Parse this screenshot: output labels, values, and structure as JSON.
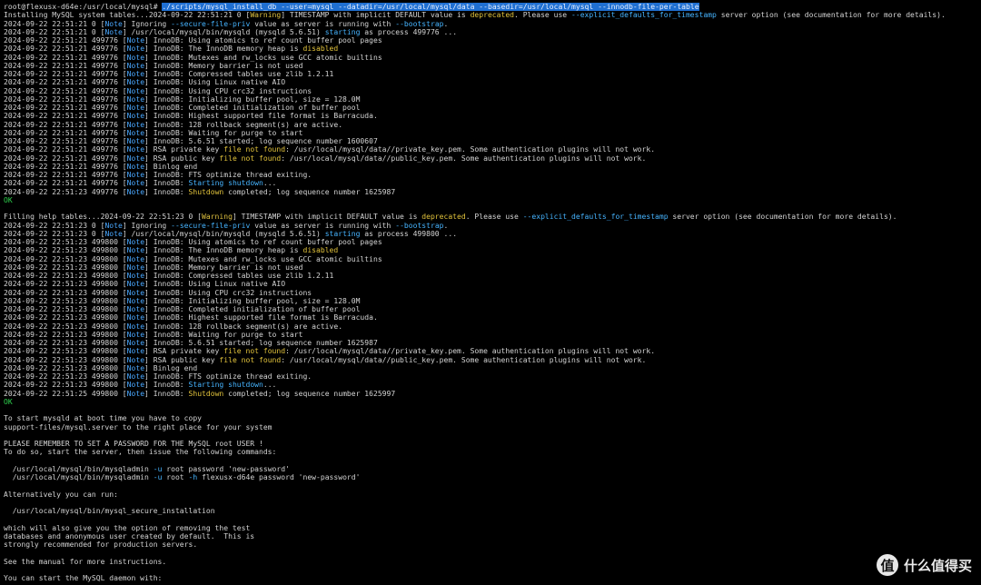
{
  "window": {
    "title": "root@flexusx-d64e: /usr/local/mysql"
  },
  "colors": {
    "background": "#000000",
    "text": "#d4d4d4",
    "note": "#4aa8ff",
    "warning": "#e0c240",
    "ok": "#2fd24e",
    "selection": "#1f6fd1"
  },
  "terminal": {
    "lines": [
      [
        [
          "root@flexusx-d64e:/usr/local/mysql# ",
          ""
        ],
        [
          "./scripts/mysql_install_db ",
          "sel"
        ],
        [
          "--user",
          "sel"
        ],
        [
          "=mysql ",
          "sel"
        ],
        [
          "--datadir",
          "sel"
        ],
        [
          "=/usr/local/mysql/data ",
          "sel"
        ],
        [
          "--basedir",
          "sel"
        ],
        [
          "=/usr/local/mysql ",
          "sel"
        ],
        [
          "--innodb-file-per-table",
          "sel"
        ]
      ],
      [
        [
          "Installing MySQL system tables...2024-09-22 22:51:21 0 [",
          ""
        ],
        [
          "Warning",
          "warn"
        ],
        [
          "] TIMESTAMP with implicit DEFAULT value is ",
          ""
        ],
        [
          "deprecated",
          "yel"
        ],
        [
          ". Please use ",
          ""
        ],
        [
          "--explicit_defaults_for_timestamp",
          "cyan"
        ],
        [
          " server option (see documentation for more details).",
          ""
        ]
      ],
      [
        [
          "2024-09-22 22:51:21 0 [",
          ""
        ],
        [
          "Note",
          "note"
        ],
        [
          "] Ignoring ",
          ""
        ],
        [
          "--secure-file-priv",
          "cyan"
        ],
        [
          " value as server is running with ",
          ""
        ],
        [
          "--bootstrap",
          "cyan"
        ],
        [
          ".",
          ""
        ]
      ],
      [
        [
          "2024-09-22 22:51:21 0 [",
          ""
        ],
        [
          "Note",
          "note"
        ],
        [
          "] /usr/local/mysql/bin/mysqld (mysqld 5.6.51) ",
          ""
        ],
        [
          "starting",
          "cyan"
        ],
        [
          " as process 499776 ...",
          ""
        ]
      ],
      [
        [
          "2024-09-22 22:51:21 499776 [",
          ""
        ],
        [
          "Note",
          "note"
        ],
        [
          "] InnoDB: Using atomics to ref count buffer pool pages",
          ""
        ]
      ],
      [
        [
          "2024-09-22 22:51:21 499776 [",
          ""
        ],
        [
          "Note",
          "note"
        ],
        [
          "] InnoDB: The InnoDB memory heap is ",
          ""
        ],
        [
          "disabled",
          "yel"
        ]
      ],
      [
        [
          "2024-09-22 22:51:21 499776 [",
          ""
        ],
        [
          "Note",
          "note"
        ],
        [
          "] InnoDB: Mutexes and rw_locks use GCC atomic builtins",
          ""
        ]
      ],
      [
        [
          "2024-09-22 22:51:21 499776 [",
          ""
        ],
        [
          "Note",
          "note"
        ],
        [
          "] InnoDB: Memory barrier is not used",
          ""
        ]
      ],
      [
        [
          "2024-09-22 22:51:21 499776 [",
          ""
        ],
        [
          "Note",
          "note"
        ],
        [
          "] InnoDB: Compressed tables use zlib 1.2.11",
          ""
        ]
      ],
      [
        [
          "2024-09-22 22:51:21 499776 [",
          ""
        ],
        [
          "Note",
          "note"
        ],
        [
          "] InnoDB: Using Linux native AIO",
          ""
        ]
      ],
      [
        [
          "2024-09-22 22:51:21 499776 [",
          ""
        ],
        [
          "Note",
          "note"
        ],
        [
          "] InnoDB: Using CPU crc32 instructions",
          ""
        ]
      ],
      [
        [
          "2024-09-22 22:51:21 499776 [",
          ""
        ],
        [
          "Note",
          "note"
        ],
        [
          "] InnoDB: Initializing buffer pool, size = 128.0M",
          ""
        ]
      ],
      [
        [
          "2024-09-22 22:51:21 499776 [",
          ""
        ],
        [
          "Note",
          "note"
        ],
        [
          "] InnoDB: Completed initialization of buffer pool",
          ""
        ]
      ],
      [
        [
          "2024-09-22 22:51:21 499776 [",
          ""
        ],
        [
          "Note",
          "note"
        ],
        [
          "] InnoDB: Highest supported file format is Barracuda.",
          ""
        ]
      ],
      [
        [
          "2024-09-22 22:51:21 499776 [",
          ""
        ],
        [
          "Note",
          "note"
        ],
        [
          "] InnoDB: 128 rollback segment(s) are active.",
          ""
        ]
      ],
      [
        [
          "2024-09-22 22:51:21 499776 [",
          ""
        ],
        [
          "Note",
          "note"
        ],
        [
          "] InnoDB: Waiting for purge to start",
          ""
        ]
      ],
      [
        [
          "2024-09-22 22:51:21 499776 [",
          ""
        ],
        [
          "Note",
          "note"
        ],
        [
          "] InnoDB: 5.6.51 started; log sequence number 1600607",
          ""
        ]
      ],
      [
        [
          "2024-09-22 22:51:21 499776 [",
          ""
        ],
        [
          "Note",
          "note"
        ],
        [
          "] RSA private key ",
          ""
        ],
        [
          "file not found",
          "yel"
        ],
        [
          ": /usr/local/mysql/data//private_key.pem. Some authentication plugins will not work.",
          ""
        ]
      ],
      [
        [
          "2024-09-22 22:51:21 499776 [",
          ""
        ],
        [
          "Note",
          "note"
        ],
        [
          "] RSA public key ",
          ""
        ],
        [
          "file not found",
          "yel"
        ],
        [
          ": /usr/local/mysql/data//public_key.pem. Some authentication plugins will not work.",
          ""
        ]
      ],
      [
        [
          "2024-09-22 22:51:21 499776 [",
          ""
        ],
        [
          "Note",
          "note"
        ],
        [
          "] Binlog end",
          ""
        ]
      ],
      [
        [
          "2024-09-22 22:51:21 499776 [",
          ""
        ],
        [
          "Note",
          "note"
        ],
        [
          "] InnoDB: FTS optimize thread exiting.",
          ""
        ]
      ],
      [
        [
          "2024-09-22 22:51:21 499776 [",
          ""
        ],
        [
          "Note",
          "note"
        ],
        [
          "] InnoDB: ",
          ""
        ],
        [
          "Starting shutdown",
          "cyan"
        ],
        [
          "...",
          ""
        ]
      ],
      [
        [
          "2024-09-22 22:51:23 499776 [",
          ""
        ],
        [
          "Note",
          "note"
        ],
        [
          "] InnoDB: ",
          ""
        ],
        [
          "Shutdown",
          "yel"
        ],
        [
          " completed; log sequence number 1625987",
          ""
        ]
      ],
      [
        [
          "OK",
          "ok"
        ]
      ],
      [
        [
          "",
          ""
        ]
      ],
      [
        [
          "Filling help tables...2024-09-22 22:51:23 0 [",
          ""
        ],
        [
          "Warning",
          "warn"
        ],
        [
          "] TIMESTAMP with implicit DEFAULT value is ",
          ""
        ],
        [
          "deprecated",
          "yel"
        ],
        [
          ". Please use ",
          ""
        ],
        [
          "--explicit_defaults_for_timestamp",
          "cyan"
        ],
        [
          " server option (see documentation for more details).",
          ""
        ]
      ],
      [
        [
          "2024-09-22 22:51:23 0 [",
          ""
        ],
        [
          "Note",
          "note"
        ],
        [
          "] Ignoring ",
          ""
        ],
        [
          "--secure-file-priv",
          "cyan"
        ],
        [
          " value as server is running with ",
          ""
        ],
        [
          "--bootstrap",
          "cyan"
        ],
        [
          ".",
          ""
        ]
      ],
      [
        [
          "2024-09-22 22:51:23 0 [",
          ""
        ],
        [
          "Note",
          "note"
        ],
        [
          "] /usr/local/mysql/bin/mysqld (mysqld 5.6.51) ",
          ""
        ],
        [
          "starting",
          "cyan"
        ],
        [
          " as process 499800 ...",
          ""
        ]
      ],
      [
        [
          "2024-09-22 22:51:23 499800 [",
          ""
        ],
        [
          "Note",
          "note"
        ],
        [
          "] InnoDB: Using atomics to ref count buffer pool pages",
          ""
        ]
      ],
      [
        [
          "2024-09-22 22:51:23 499800 [",
          ""
        ],
        [
          "Note",
          "note"
        ],
        [
          "] InnoDB: The InnoDB memory heap is ",
          ""
        ],
        [
          "disabled",
          "yel"
        ]
      ],
      [
        [
          "2024-09-22 22:51:23 499800 [",
          ""
        ],
        [
          "Note",
          "note"
        ],
        [
          "] InnoDB: Mutexes and rw_locks use GCC atomic builtins",
          ""
        ]
      ],
      [
        [
          "2024-09-22 22:51:23 499800 [",
          ""
        ],
        [
          "Note",
          "note"
        ],
        [
          "] InnoDB: Memory barrier is not used",
          ""
        ]
      ],
      [
        [
          "2024-09-22 22:51:23 499800 [",
          ""
        ],
        [
          "Note",
          "note"
        ],
        [
          "] InnoDB: Compressed tables use zlib 1.2.11",
          ""
        ]
      ],
      [
        [
          "2024-09-22 22:51:23 499800 [",
          ""
        ],
        [
          "Note",
          "note"
        ],
        [
          "] InnoDB: Using Linux native AIO",
          ""
        ]
      ],
      [
        [
          "2024-09-22 22:51:23 499800 [",
          ""
        ],
        [
          "Note",
          "note"
        ],
        [
          "] InnoDB: Using CPU crc32 instructions",
          ""
        ]
      ],
      [
        [
          "2024-09-22 22:51:23 499800 [",
          ""
        ],
        [
          "Note",
          "note"
        ],
        [
          "] InnoDB: Initializing buffer pool, size = 128.0M",
          ""
        ]
      ],
      [
        [
          "2024-09-22 22:51:23 499800 [",
          ""
        ],
        [
          "Note",
          "note"
        ],
        [
          "] InnoDB: Completed initialization of buffer pool",
          ""
        ]
      ],
      [
        [
          "2024-09-22 22:51:23 499800 [",
          ""
        ],
        [
          "Note",
          "note"
        ],
        [
          "] InnoDB: Highest supported file format is Barracuda.",
          ""
        ]
      ],
      [
        [
          "2024-09-22 22:51:23 499800 [",
          ""
        ],
        [
          "Note",
          "note"
        ],
        [
          "] InnoDB: 128 rollback segment(s) are active.",
          ""
        ]
      ],
      [
        [
          "2024-09-22 22:51:23 499800 [",
          ""
        ],
        [
          "Note",
          "note"
        ],
        [
          "] InnoDB: Waiting for purge to start",
          ""
        ]
      ],
      [
        [
          "2024-09-22 22:51:23 499800 [",
          ""
        ],
        [
          "Note",
          "note"
        ],
        [
          "] InnoDB: 5.6.51 started; log sequence number 1625987",
          ""
        ]
      ],
      [
        [
          "2024-09-22 22:51:23 499800 [",
          ""
        ],
        [
          "Note",
          "note"
        ],
        [
          "] RSA private key ",
          ""
        ],
        [
          "file not found",
          "yel"
        ],
        [
          ": /usr/local/mysql/data//private_key.pem. Some authentication plugins will not work.",
          ""
        ]
      ],
      [
        [
          "2024-09-22 22:51:23 499800 [",
          ""
        ],
        [
          "Note",
          "note"
        ],
        [
          "] RSA public key ",
          ""
        ],
        [
          "file not found",
          "yel"
        ],
        [
          ": /usr/local/mysql/data//public_key.pem. Some authentication plugins will not work.",
          ""
        ]
      ],
      [
        [
          "2024-09-22 22:51:23 499800 [",
          ""
        ],
        [
          "Note",
          "note"
        ],
        [
          "] Binlog end",
          ""
        ]
      ],
      [
        [
          "2024-09-22 22:51:23 499800 [",
          ""
        ],
        [
          "Note",
          "note"
        ],
        [
          "] InnoDB: FTS optimize thread exiting.",
          ""
        ]
      ],
      [
        [
          "2024-09-22 22:51:23 499800 [",
          ""
        ],
        [
          "Note",
          "note"
        ],
        [
          "] InnoDB: ",
          ""
        ],
        [
          "Starting shutdown",
          "cyan"
        ],
        [
          "...",
          ""
        ]
      ],
      [
        [
          "2024-09-22 22:51:25 499800 [",
          ""
        ],
        [
          "Note",
          "note"
        ],
        [
          "] InnoDB: ",
          ""
        ],
        [
          "Shutdown",
          "yel"
        ],
        [
          " completed; log sequence number 1625997",
          ""
        ]
      ],
      [
        [
          "OK",
          "ok"
        ]
      ],
      [
        [
          "",
          ""
        ]
      ],
      [
        [
          "To start mysqld at boot time you have to copy",
          ""
        ]
      ],
      [
        [
          "support-files/mysql.server to the right place for your system",
          ""
        ]
      ],
      [
        [
          "",
          ""
        ]
      ],
      [
        [
          "PLEASE REMEMBER TO SET A PASSWORD FOR THE MySQL root USER !",
          ""
        ]
      ],
      [
        [
          "To do so, start the server, then issue the following commands:",
          ""
        ]
      ],
      [
        [
          "",
          ""
        ]
      ],
      [
        [
          "  /usr/local/mysql/bin/mysqladmin ",
          ""
        ],
        [
          "-u",
          "cyan"
        ],
        [
          " root password 'new-password'",
          ""
        ]
      ],
      [
        [
          "  /usr/local/mysql/bin/mysqladmin ",
          ""
        ],
        [
          "-u",
          "cyan"
        ],
        [
          " root ",
          ""
        ],
        [
          "-h",
          "cyan"
        ],
        [
          " flexusx-d64e password 'new-password'",
          ""
        ]
      ],
      [
        [
          "",
          ""
        ]
      ],
      [
        [
          "Alternatively you can run:",
          ""
        ]
      ],
      [
        [
          "",
          ""
        ]
      ],
      [
        [
          "  /usr/local/mysql/bin/mysql_secure_installation",
          ""
        ]
      ],
      [
        [
          "",
          ""
        ]
      ],
      [
        [
          "which will also give you the option of removing the test",
          ""
        ]
      ],
      [
        [
          "databases and anonymous user created by default.  This is",
          ""
        ]
      ],
      [
        [
          "strongly recommended for production servers.",
          ""
        ]
      ],
      [
        [
          "",
          ""
        ]
      ],
      [
        [
          "See the manual for more instructions.",
          ""
        ]
      ],
      [
        [
          "",
          ""
        ]
      ],
      [
        [
          "You can start the MySQL daemon with:",
          ""
        ]
      ]
    ]
  },
  "watermark": {
    "badge": "值",
    "text": "什么值得买",
    "icon": "smzdm-logo-icon"
  }
}
